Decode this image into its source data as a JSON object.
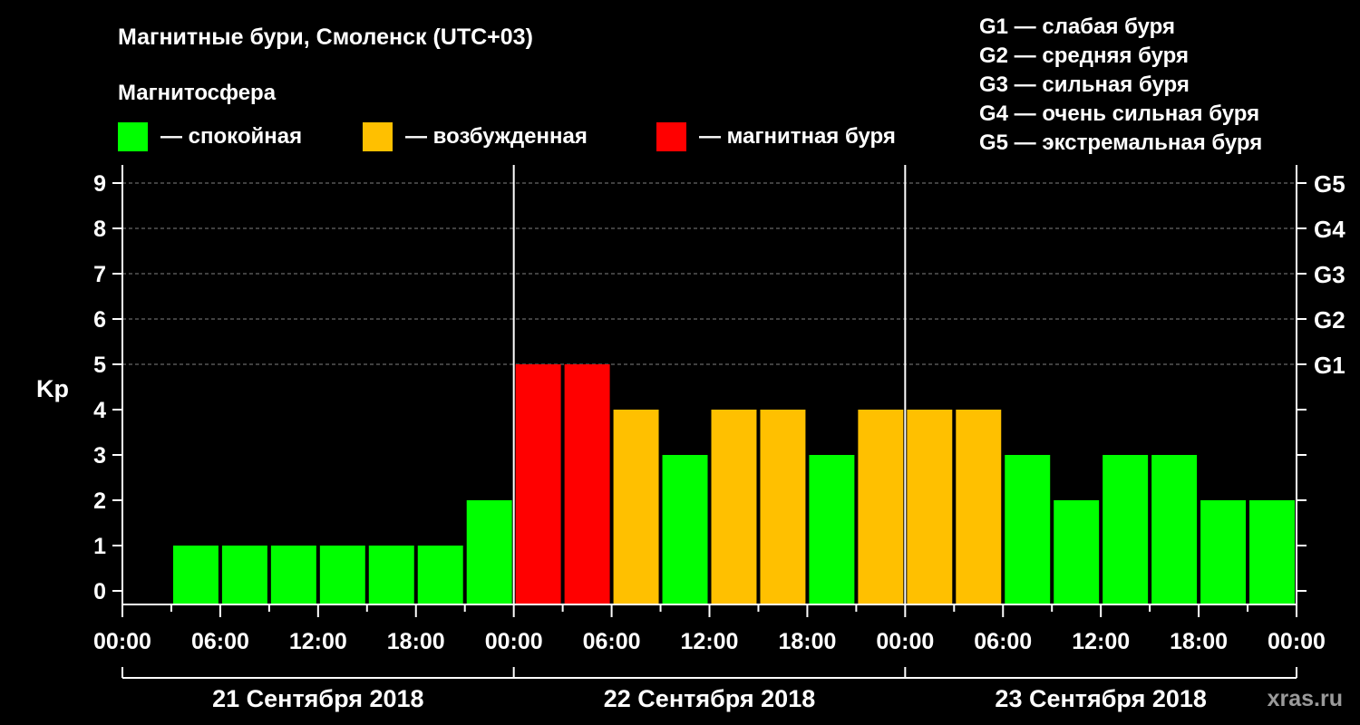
{
  "title": "Магнитные бури, Смоленск (UTC+03)",
  "legend": {
    "heading": "Магнитосфера",
    "items": [
      {
        "label": "— спокойная",
        "color": "#00ff00"
      },
      {
        "label": "— возбужденная",
        "color": "#ffc000"
      },
      {
        "label": "— магнитная буря",
        "color": "#ff0000"
      }
    ]
  },
  "storm_scale": [
    "G1 — слабая буря",
    "G2 — средняя буря",
    "G3 — сильная буря",
    "G4 — очень сильная буря",
    "G5 — экстремальная буря"
  ],
  "watermark": "xras.ru",
  "colors": {
    "background": "#000000",
    "axis": "#ffffff",
    "grid": "#808080",
    "quiet": "#00ff00",
    "active": "#ffc000",
    "storm": "#ff0000"
  },
  "chart_data": {
    "type": "bar",
    "ylabel": "Kp",
    "ylim": [
      0,
      9
    ],
    "yticks": [
      "0",
      "1",
      "2",
      "3",
      "4",
      "5",
      "6",
      "7",
      "8",
      "9"
    ],
    "y2ticks": [
      {
        "kp": 5,
        "label": "G1"
      },
      {
        "kp": 6,
        "label": "G2"
      },
      {
        "kp": 7,
        "label": "G3"
      },
      {
        "kp": 8,
        "label": "G4"
      },
      {
        "kp": 9,
        "label": "G5"
      }
    ],
    "xtick_labels": [
      "00:00",
      "06:00",
      "12:00",
      "18:00",
      "00:00",
      "06:00",
      "12:00",
      "18:00",
      "00:00",
      "06:00",
      "12:00",
      "18:00",
      "00:00"
    ],
    "days": [
      "21 Сентября 2018",
      "22 Сентября 2018",
      "23 Сентября 2018"
    ],
    "interval_hours": 3,
    "grid": "horizontal dashed at Kp 5–9",
    "series": [
      {
        "values": [
          null,
          1,
          1,
          1,
          1,
          1,
          1,
          2,
          5,
          5,
          4,
          3,
          4,
          4,
          3,
          4,
          4,
          4,
          3,
          2,
          3,
          3,
          2,
          2
        ],
        "levels": [
          "",
          "quiet",
          "quiet",
          "quiet",
          "quiet",
          "quiet",
          "quiet",
          "quiet",
          "storm",
          "storm",
          "active",
          "quiet",
          "active",
          "active",
          "quiet",
          "active",
          "active",
          "active",
          "quiet",
          "quiet",
          "quiet",
          "quiet",
          "quiet",
          "quiet"
        ]
      }
    ]
  }
}
